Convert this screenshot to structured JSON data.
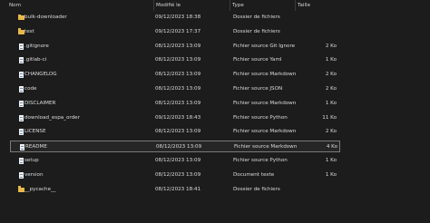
{
  "columns": {
    "name": "Nom",
    "modified": "Modifié le",
    "type": "Type",
    "size": "Taille"
  },
  "files": [
    {
      "name": "bulk-downloader",
      "modified": "09/12/2023 18:38",
      "type": "Dossier de fichiers",
      "size": "",
      "icon": "folder-icon"
    },
    {
      "name": "test",
      "modified": "09/12/2023 17:37",
      "type": "Dossier de fichiers",
      "size": "",
      "icon": "folder-icon"
    },
    {
      "name": ".gitignore",
      "modified": "08/12/2023 13:09",
      "type": "Fichier source Git Ignore",
      "size": "2 Ko",
      "icon": "file-icon"
    },
    {
      "name": ".gitlab-ci",
      "modified": "08/12/2023 13:09",
      "type": "Fichier source Yaml",
      "size": "1 Ko",
      "icon": "file-icon"
    },
    {
      "name": "CHANGELOG",
      "modified": "08/12/2023 13:09",
      "type": "Fichier source Markdown",
      "size": "2 Ko",
      "icon": "file-icon"
    },
    {
      "name": "code",
      "modified": "08/12/2023 13:09",
      "type": "Fichier source JSON",
      "size": "2 Ko",
      "icon": "file-icon"
    },
    {
      "name": "DISCLAIMER",
      "modified": "08/12/2023 13:09",
      "type": "Fichier source Markdown",
      "size": "1 Ko",
      "icon": "file-icon"
    },
    {
      "name": "download_espa_order",
      "modified": "09/12/2023 18:43",
      "type": "Fichier source Python",
      "size": "11 Ko",
      "icon": "file-icon"
    },
    {
      "name": "LICENSE",
      "modified": "08/12/2023 13:09",
      "type": "Fichier source Markdown",
      "size": "2 Ko",
      "icon": "file-icon"
    },
    {
      "name": "README",
      "modified": "08/12/2023 13:09",
      "type": "Fichier source Markdown",
      "size": "4 Ko",
      "icon": "file-icon",
      "selected": true
    },
    {
      "name": "setup",
      "modified": "08/12/2023 13:09",
      "type": "Fichier source Python",
      "size": "1 Ko",
      "icon": "file-icon"
    },
    {
      "name": "version",
      "modified": "08/12/2023 13:09",
      "type": "Document texte",
      "size": "1 Ko",
      "icon": "file-icon"
    },
    {
      "name": "__pycache__",
      "modified": "08/12/2023 18:41",
      "type": "Dossier de fichiers",
      "size": "",
      "icon": "folder-icon"
    }
  ]
}
